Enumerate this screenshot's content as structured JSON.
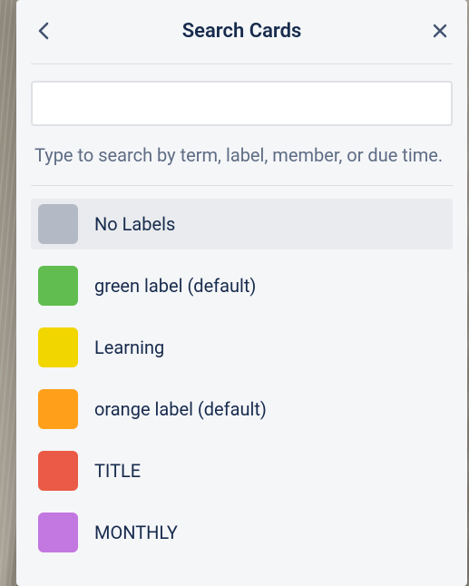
{
  "header": {
    "title": "Search Cards"
  },
  "search": {
    "value": "",
    "placeholder": ""
  },
  "help_text": "Type to search by term, label, member, or due time.",
  "labels": [
    {
      "name": "No Labels",
      "color": "#b3bac5",
      "selected": true
    },
    {
      "name": "green label (default)",
      "color": "#61bd4f",
      "selected": false
    },
    {
      "name": "Learning",
      "color": "#f2d600",
      "selected": false
    },
    {
      "name": "orange label (default)",
      "color": "#ff9f1a",
      "selected": false
    },
    {
      "name": "TITLE",
      "color": "#eb5a46",
      "selected": false
    },
    {
      "name": "MONTHLY",
      "color": "#c377e0",
      "selected": false
    }
  ]
}
